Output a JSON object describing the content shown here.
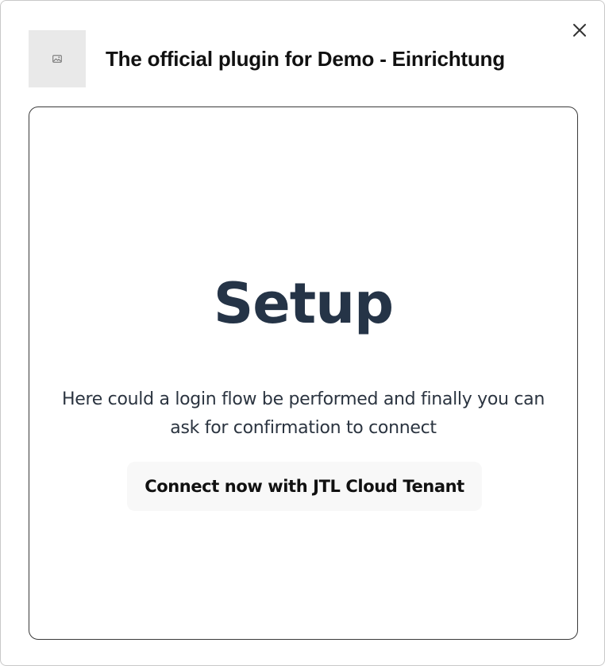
{
  "dialog": {
    "title": "The official plugin for Demo - Einrichtung",
    "close_icon": "close-icon",
    "logo_icon": "image-placeholder-icon"
  },
  "setup": {
    "heading": "Setup",
    "description": "Here could a login flow be performed and finally you can ask for confirmation to connect",
    "connect_label": "Connect now with JTL Cloud Tenant"
  },
  "colors": {
    "heading": "#253447",
    "text": "#2b3440",
    "button_bg": "#f8f8f8",
    "logo_bg": "#e9e9e9"
  }
}
